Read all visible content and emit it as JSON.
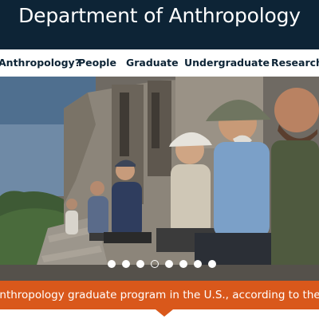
{
  "header": {
    "title": "Department of Anthropology"
  },
  "nav": {
    "items": [
      {
        "label": "Anthropology?"
      },
      {
        "label": "People"
      },
      {
        "label": "Graduate"
      },
      {
        "label": "Undergraduate"
      },
      {
        "label": "Research"
      }
    ]
  },
  "hero": {
    "slide_count": 8,
    "active_slide_index": 3
  },
  "banner": {
    "text": "op anthropology graduate program in the U.S., according to the N"
  },
  "colors": {
    "header_bg": "#0d2436",
    "nav_text": "#0d2436",
    "banner_bg": "#d9581b"
  }
}
